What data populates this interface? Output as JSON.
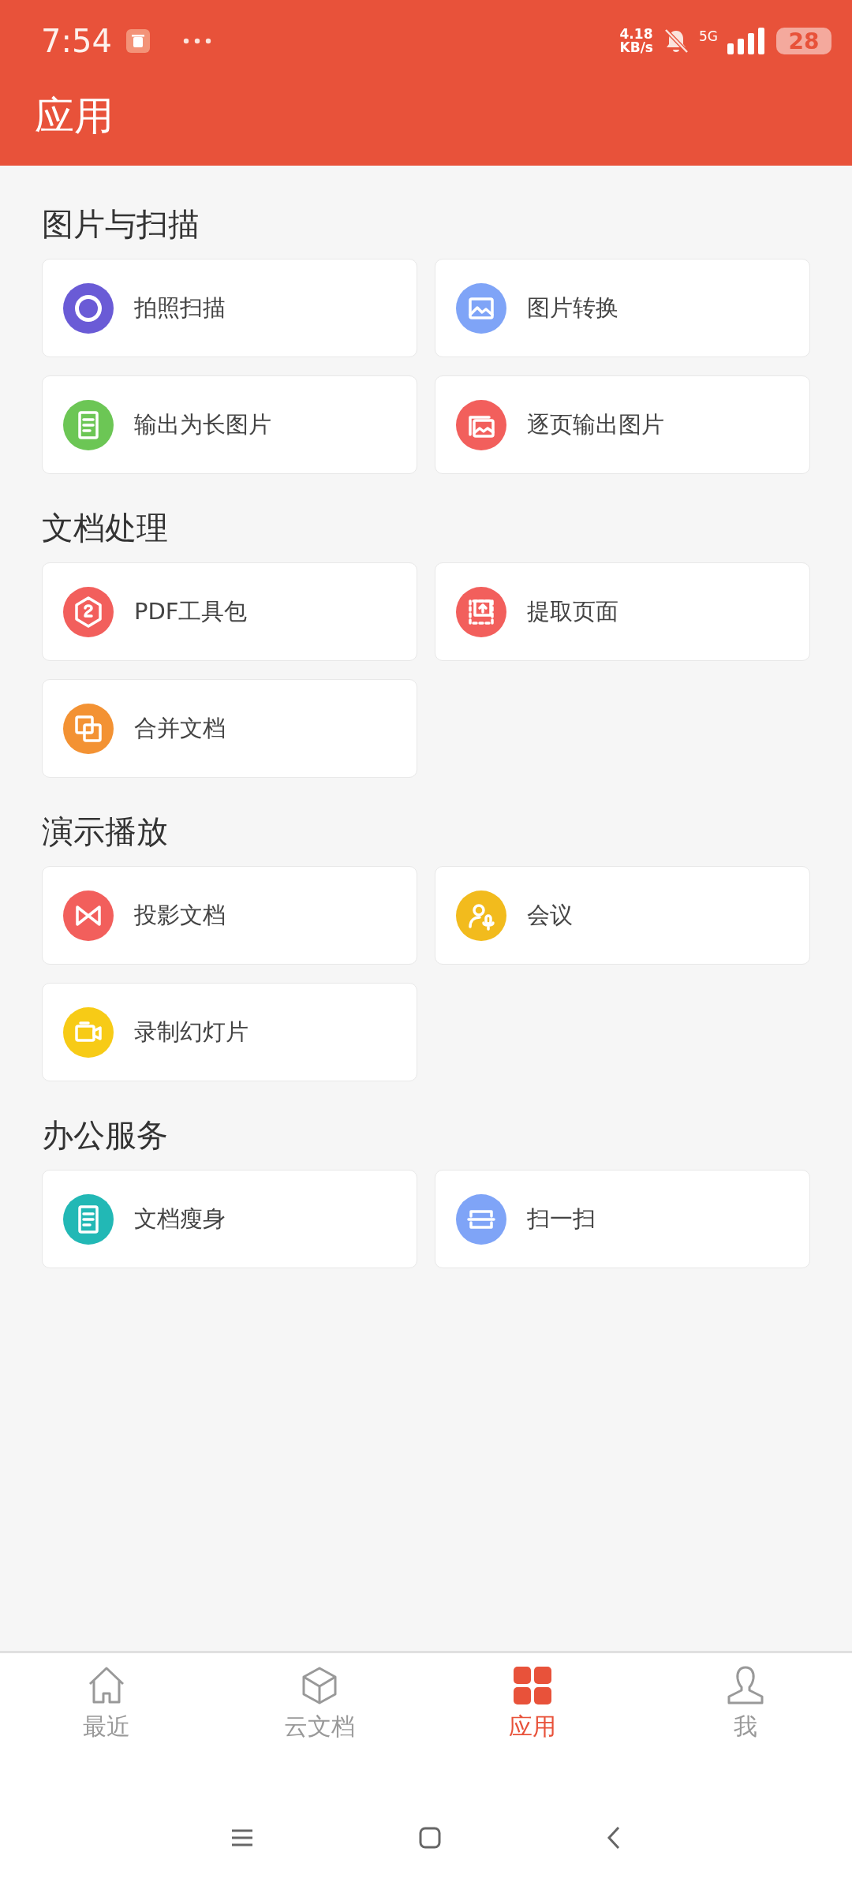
{
  "status_bar": {
    "time": "7:54",
    "speed_value": "4.18",
    "speed_unit": "KB/s",
    "network": "5G",
    "battery": "28"
  },
  "header": {
    "title": "应用"
  },
  "sections": [
    {
      "title": "图片与扫描",
      "items": [
        {
          "label": "拍照扫描",
          "kind": "camera",
          "color": "#6a5bd6"
        },
        {
          "label": "图片转换",
          "kind": "image",
          "color": "#7fa4f7"
        },
        {
          "label": "输出为长图片",
          "kind": "longpage",
          "color": "#6cc655"
        },
        {
          "label": "逐页输出图片",
          "kind": "images",
          "color": "#f25f5c"
        }
      ]
    },
    {
      "title": "文档处理",
      "items": [
        {
          "label": "PDF工具包",
          "kind": "pdf",
          "color": "#f25f5c"
        },
        {
          "label": "提取页面",
          "kind": "extract",
          "color": "#f25f5c"
        },
        {
          "label": "合并文档",
          "kind": "merge",
          "color": "#f39233"
        }
      ]
    },
    {
      "title": "演示播放",
      "items": [
        {
          "label": "投影文档",
          "kind": "project",
          "color": "#f25f5c"
        },
        {
          "label": "会议",
          "kind": "meeting",
          "color": "#f2bb1d"
        },
        {
          "label": "录制幻灯片",
          "kind": "record",
          "color": "#f7cb16"
        }
      ]
    },
    {
      "title": "办公服务",
      "items": [
        {
          "label": "文档瘦身",
          "kind": "slim",
          "color": "#22b8b5"
        },
        {
          "label": "扫一扫",
          "kind": "scan",
          "color": "#7fa4f7"
        }
      ]
    }
  ],
  "tabs": [
    {
      "label": "最近",
      "kind": "home",
      "selected": false
    },
    {
      "label": "云文档",
      "kind": "cloud",
      "selected": false
    },
    {
      "label": "应用",
      "kind": "apps",
      "selected": true
    },
    {
      "label": "我",
      "kind": "me",
      "selected": false
    }
  ]
}
